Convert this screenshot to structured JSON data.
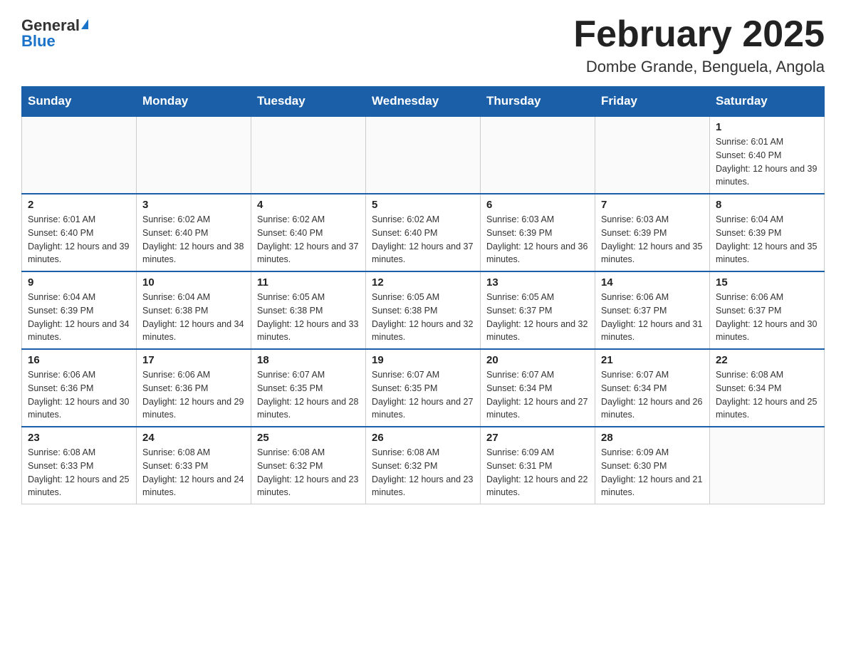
{
  "header": {
    "logo_general": "General",
    "logo_blue": "Blue",
    "month_title": "February 2025",
    "location": "Dombe Grande, Benguela, Angola"
  },
  "days_of_week": [
    "Sunday",
    "Monday",
    "Tuesday",
    "Wednesday",
    "Thursday",
    "Friday",
    "Saturday"
  ],
  "weeks": [
    [
      {
        "day": "",
        "info": ""
      },
      {
        "day": "",
        "info": ""
      },
      {
        "day": "",
        "info": ""
      },
      {
        "day": "",
        "info": ""
      },
      {
        "day": "",
        "info": ""
      },
      {
        "day": "",
        "info": ""
      },
      {
        "day": "1",
        "info": "Sunrise: 6:01 AM\nSunset: 6:40 PM\nDaylight: 12 hours and 39 minutes."
      }
    ],
    [
      {
        "day": "2",
        "info": "Sunrise: 6:01 AM\nSunset: 6:40 PM\nDaylight: 12 hours and 39 minutes."
      },
      {
        "day": "3",
        "info": "Sunrise: 6:02 AM\nSunset: 6:40 PM\nDaylight: 12 hours and 38 minutes."
      },
      {
        "day": "4",
        "info": "Sunrise: 6:02 AM\nSunset: 6:40 PM\nDaylight: 12 hours and 37 minutes."
      },
      {
        "day": "5",
        "info": "Sunrise: 6:02 AM\nSunset: 6:40 PM\nDaylight: 12 hours and 37 minutes."
      },
      {
        "day": "6",
        "info": "Sunrise: 6:03 AM\nSunset: 6:39 PM\nDaylight: 12 hours and 36 minutes."
      },
      {
        "day": "7",
        "info": "Sunrise: 6:03 AM\nSunset: 6:39 PM\nDaylight: 12 hours and 35 minutes."
      },
      {
        "day": "8",
        "info": "Sunrise: 6:04 AM\nSunset: 6:39 PM\nDaylight: 12 hours and 35 minutes."
      }
    ],
    [
      {
        "day": "9",
        "info": "Sunrise: 6:04 AM\nSunset: 6:39 PM\nDaylight: 12 hours and 34 minutes."
      },
      {
        "day": "10",
        "info": "Sunrise: 6:04 AM\nSunset: 6:38 PM\nDaylight: 12 hours and 34 minutes."
      },
      {
        "day": "11",
        "info": "Sunrise: 6:05 AM\nSunset: 6:38 PM\nDaylight: 12 hours and 33 minutes."
      },
      {
        "day": "12",
        "info": "Sunrise: 6:05 AM\nSunset: 6:38 PM\nDaylight: 12 hours and 32 minutes."
      },
      {
        "day": "13",
        "info": "Sunrise: 6:05 AM\nSunset: 6:37 PM\nDaylight: 12 hours and 32 minutes."
      },
      {
        "day": "14",
        "info": "Sunrise: 6:06 AM\nSunset: 6:37 PM\nDaylight: 12 hours and 31 minutes."
      },
      {
        "day": "15",
        "info": "Sunrise: 6:06 AM\nSunset: 6:37 PM\nDaylight: 12 hours and 30 minutes."
      }
    ],
    [
      {
        "day": "16",
        "info": "Sunrise: 6:06 AM\nSunset: 6:36 PM\nDaylight: 12 hours and 30 minutes."
      },
      {
        "day": "17",
        "info": "Sunrise: 6:06 AM\nSunset: 6:36 PM\nDaylight: 12 hours and 29 minutes."
      },
      {
        "day": "18",
        "info": "Sunrise: 6:07 AM\nSunset: 6:35 PM\nDaylight: 12 hours and 28 minutes."
      },
      {
        "day": "19",
        "info": "Sunrise: 6:07 AM\nSunset: 6:35 PM\nDaylight: 12 hours and 27 minutes."
      },
      {
        "day": "20",
        "info": "Sunrise: 6:07 AM\nSunset: 6:34 PM\nDaylight: 12 hours and 27 minutes."
      },
      {
        "day": "21",
        "info": "Sunrise: 6:07 AM\nSunset: 6:34 PM\nDaylight: 12 hours and 26 minutes."
      },
      {
        "day": "22",
        "info": "Sunrise: 6:08 AM\nSunset: 6:34 PM\nDaylight: 12 hours and 25 minutes."
      }
    ],
    [
      {
        "day": "23",
        "info": "Sunrise: 6:08 AM\nSunset: 6:33 PM\nDaylight: 12 hours and 25 minutes."
      },
      {
        "day": "24",
        "info": "Sunrise: 6:08 AM\nSunset: 6:33 PM\nDaylight: 12 hours and 24 minutes."
      },
      {
        "day": "25",
        "info": "Sunrise: 6:08 AM\nSunset: 6:32 PM\nDaylight: 12 hours and 23 minutes."
      },
      {
        "day": "26",
        "info": "Sunrise: 6:08 AM\nSunset: 6:32 PM\nDaylight: 12 hours and 23 minutes."
      },
      {
        "day": "27",
        "info": "Sunrise: 6:09 AM\nSunset: 6:31 PM\nDaylight: 12 hours and 22 minutes."
      },
      {
        "day": "28",
        "info": "Sunrise: 6:09 AM\nSunset: 6:30 PM\nDaylight: 12 hours and 21 minutes."
      },
      {
        "day": "",
        "info": ""
      }
    ]
  ]
}
